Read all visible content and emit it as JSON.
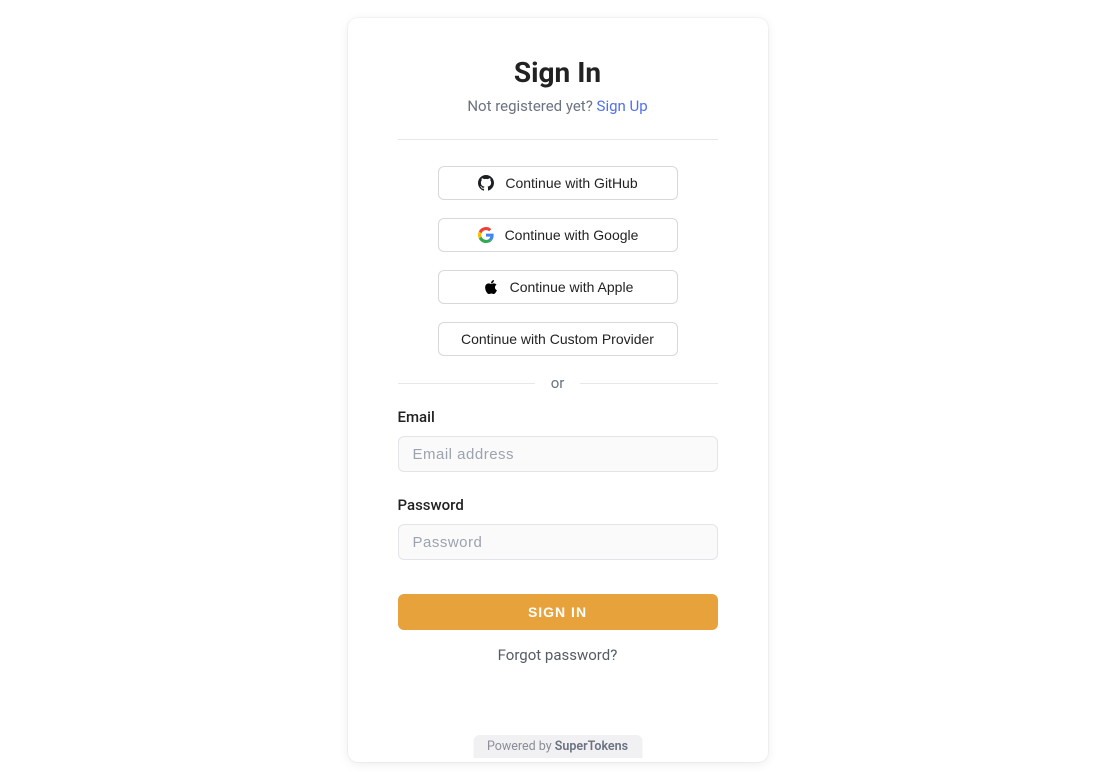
{
  "header": {
    "title": "Sign In",
    "subtitle_text": "Not registered yet? ",
    "signup_link": "Sign Up"
  },
  "social": {
    "github": "Continue with GitHub",
    "google": "Continue with Google",
    "apple": "Continue with Apple",
    "custom": "Continue with Custom Provider"
  },
  "divider": {
    "or": "or"
  },
  "form": {
    "email_label": "Email",
    "email_placeholder": "Email address",
    "password_label": "Password",
    "password_placeholder": "Password",
    "submit": "SIGN IN",
    "forgot": "Forgot password?"
  },
  "footer": {
    "powered_by": "Powered by ",
    "brand": "SuperTokens"
  }
}
